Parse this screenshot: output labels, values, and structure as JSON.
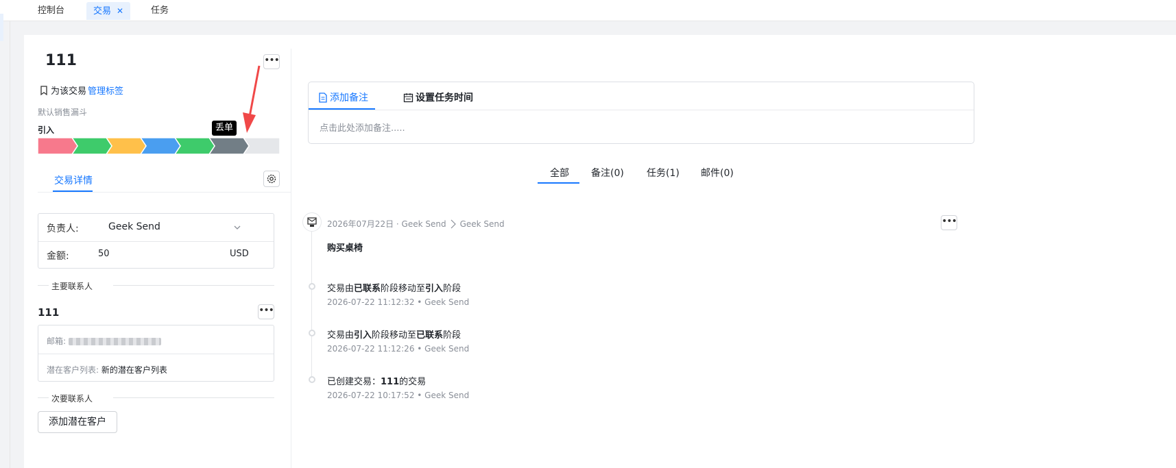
{
  "tabs": [
    {
      "label": "控制台",
      "active": false
    },
    {
      "label": "交易",
      "active": true,
      "closable": true
    },
    {
      "label": "任务",
      "active": false
    }
  ],
  "deal": {
    "title": "111",
    "tag_prefix": "为该交易",
    "tag_link": "管理标签",
    "funnel": "默认销售漏斗",
    "current_stage": "引入",
    "tooltip": "丢单",
    "stage_colors": [
      "#f7798c",
      "#3ecb6b",
      "#ffc04a",
      "#4a9ef0",
      "#3ecb6b",
      "#727e86",
      "#e5e7ea"
    ]
  },
  "details": {
    "tab_label": "交易详情",
    "owner_label": "负责人:",
    "owner_value": "Geek Send",
    "amount_label": "金额:",
    "amount_value": "50",
    "currency": "USD"
  },
  "primary_contact": {
    "section_title": "主要联系人",
    "name": "111",
    "email_label": "邮箱:",
    "list_label": "潜在客户列表:",
    "list_value": "新的潜在客户列表"
  },
  "secondary_contact": {
    "section_title": "次要联系人",
    "add_button": "添加潜在客户"
  },
  "notes": {
    "tab_add_note": "添加备注",
    "tab_set_task": "设置任务时间",
    "placeholder": "点击此处添加备注....."
  },
  "filters": [
    {
      "label": "全部",
      "active": true
    },
    {
      "label": "备注(0)"
    },
    {
      "label": "任务(1)"
    },
    {
      "label": "邮件(0)"
    }
  ],
  "timeline": {
    "email_event": {
      "date": "2026年07月22日 · Geek Send",
      "to": "Geek Send",
      "subject": "购买桌椅"
    },
    "events": [
      {
        "pre": "交易由",
        "b1": "已联系",
        "mid": "阶段移动至",
        "b2": "引入",
        "post": "阶段",
        "meta": "2026-07-22 11:12:32  • Geek Send"
      },
      {
        "pre": "交易由",
        "b1": "引入",
        "mid": "阶段移动至",
        "b2": "已联系",
        "post": "阶段",
        "meta": "2026-07-22 11:12:26  • Geek Send"
      },
      {
        "pre": "已创建交易：",
        "b1": "111",
        "mid": "的交易",
        "b2": "",
        "post": "",
        "meta": "2026-07-22 10:17:52  • Geek Send"
      }
    ]
  }
}
